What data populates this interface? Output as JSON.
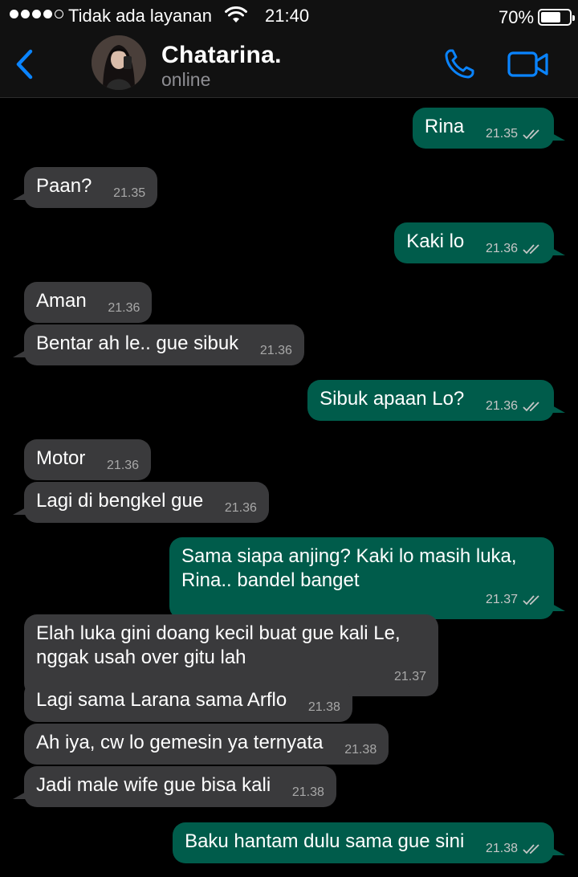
{
  "status_bar": {
    "carrier": "Tidak ada layanan",
    "time": "21:40",
    "battery": "70%",
    "battery_level": 0.7
  },
  "header": {
    "name": "Chatarina.",
    "status": "online"
  },
  "colors": {
    "accent": "#0a84ff",
    "incoming_bubble": "#3a3a3c",
    "outgoing_bubble": "#005c4b"
  },
  "messages": [
    {
      "dir": "out",
      "text": "Rina",
      "time": "21.35"
    },
    {
      "dir": "in",
      "text": "Paan?",
      "time": "21.35"
    },
    {
      "dir": "out",
      "text": "Kaki lo",
      "time": "21.36"
    },
    {
      "dir": "in",
      "text": "Aman",
      "time": "21.36"
    },
    {
      "dir": "in",
      "text": "Bentar ah le.. gue sibuk",
      "time": "21.36"
    },
    {
      "dir": "out",
      "text": "Sibuk apaan Lo?",
      "time": "21.36"
    },
    {
      "dir": "in",
      "text": "Motor",
      "time": "21.36"
    },
    {
      "dir": "in",
      "text": "Lagi di bengkel gue",
      "time": "21.36"
    },
    {
      "dir": "out",
      "text": "Sama siapa anjing? Kaki lo masih luka, Rina.. bandel banget",
      "time": "21.37"
    },
    {
      "dir": "in",
      "text": "Elah luka gini doang kecil buat gue kali Le, nggak usah over gitu lah",
      "time": "21.37"
    },
    {
      "dir": "in",
      "text": "Lagi sama Larana sama Arflo",
      "time": "21.38"
    },
    {
      "dir": "in",
      "text": "Ah iya, cw lo gemesin ya ternyata",
      "time": "21.38"
    },
    {
      "dir": "in",
      "text": "Jadi male wife gue bisa kali",
      "time": "21.38"
    },
    {
      "dir": "out",
      "text": "Baku hantam dulu sama gue sini",
      "time": "21.38"
    }
  ]
}
